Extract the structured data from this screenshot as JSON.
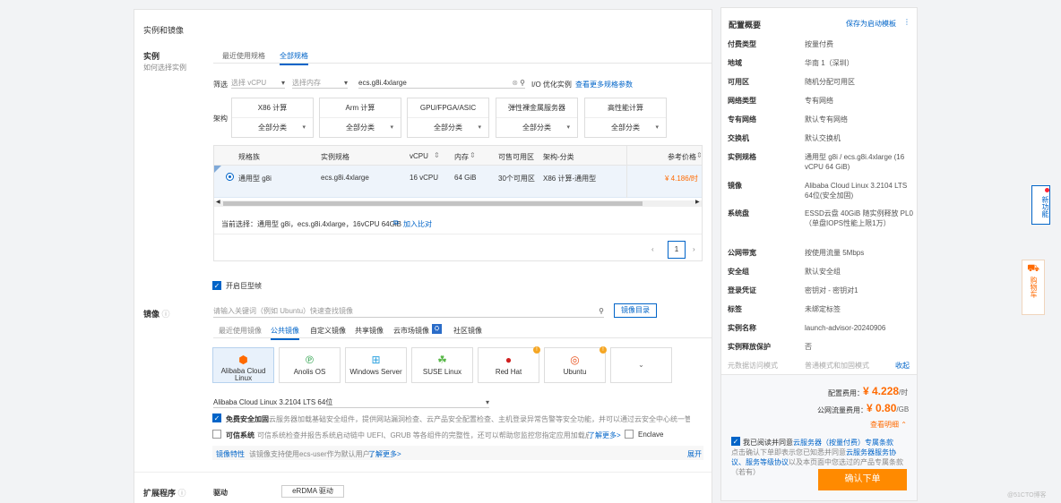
{
  "main": {
    "section_title": "实例和镜像",
    "instance": {
      "label": "实例",
      "help": "如何选择实例",
      "tabs": [
        "最近使用规格",
        "全部规格"
      ],
      "filter_label": "筛选",
      "vcpu_placeholder": "选择 vCPU",
      "memory_placeholder": "选择内存",
      "search_value": "ecs.g8i.4xlarge",
      "io_label": "I/O 优化实例",
      "more_link": "查看更多规格参数",
      "arch_label": "架构",
      "arch_categories": [
        {
          "name": "X86 计算",
          "value": "全部分类"
        },
        {
          "name": "Arm 计算",
          "value": "全部分类"
        },
        {
          "name": "GPU/FPGA/ASIC",
          "value": "全部分类"
        },
        {
          "name": "弹性裸金属服务器",
          "value": "全部分类"
        },
        {
          "name": "高性能计算",
          "value": "全部分类"
        }
      ],
      "table_headers": [
        "规格族",
        "实例规格",
        "vCPU",
        "内存",
        "可售可用区",
        "架构-分类",
        "参考价格"
      ],
      "table_row": {
        "family": "通用型 g8i",
        "spec": "ecs.g8i.4xlarge",
        "vcpu": "16 vCPU",
        "memory": "64 GiB",
        "zones": "30个可用区",
        "arch": "X86 计算-通用型",
        "price": "¥ 4.186/时"
      },
      "current_selection": "当前选择：通用型 g8i，ecs.g8i.4xlarge，16vCPU 64GiB",
      "compare_link": "加入比对",
      "page": "1",
      "hugepage_label": "开启巨型帧"
    },
    "image": {
      "label": "镜像",
      "search_placeholder": "请输入关键词（例如 Ubuntu）快速查找镜像",
      "catalog_button": "镜像目录",
      "tabs": [
        "最近使用镜像",
        "公共镜像",
        "自定义镜像",
        "共享镜像",
        "云市场镜像",
        "社区镜像"
      ],
      "os_cards": [
        "Alibaba Cloud Linux",
        "Anolis OS",
        "Windows Server",
        "SUSE Linux",
        "Red Hat",
        "Ubuntu"
      ],
      "version": "Alibaba Cloud Linux 3.2104 LTS 64位",
      "security_label": "免费安全加固",
      "security_desc": "云服务器加载基础安全组件，提供网站漏洞检查、云产品安全配置检查、主机登录异常告警等安全功能，并可以通过云安全中心统一管理",
      "trusted_label": "可信系统",
      "trusted_desc": "可信系统检查并报告系统启动链中 UEFI、GRUB 等各组件的完整性，还可以帮助您监控您指定应用加载启动情况。",
      "trusted_link": "了解更多>",
      "enclave_label": "Enclave",
      "feature_tag": "镜像特性",
      "feature_desc": "该镜像支持使用ecs-user作为默认用户，",
      "feature_link": "了解更多>",
      "expand": "展开"
    },
    "extension": {
      "label": "扩展程序",
      "driver_label": "驱动",
      "driver_button": "eRDMA 驱动"
    }
  },
  "summary": {
    "title": "配置概要",
    "save_link": "保存为启动模板",
    "rows": [
      {
        "k": "付费类型",
        "v": "按量付费"
      },
      {
        "k": "地域",
        "v": "华南 1（深圳）"
      },
      {
        "k": "可用区",
        "v": "随机分配可用区"
      },
      {
        "k": "网络类型",
        "v": "专有网络"
      },
      {
        "k": "专有网络",
        "v": "默认专有网络"
      },
      {
        "k": "交换机",
        "v": "默认交换机"
      },
      {
        "k": "实例规格",
        "v": "通用型 g8i / ecs.g8i.4xlarge (16 vCPU 64 GiB)"
      },
      {
        "k": "镜像",
        "v": "Alibaba Cloud Linux 3.2104 LTS 64位(安全加固)"
      },
      {
        "k": "系统盘",
        "v": "ESSD云盘 40GiB 随实例释放 PL0（单盘IOPS性能上限1万）"
      },
      {
        "k": "公网带宽",
        "v": "按使用流量 5Mbps"
      },
      {
        "k": "安全组",
        "v": "默认安全组"
      },
      {
        "k": "登录凭证",
        "v": "密钥对 - 密钥对1"
      },
      {
        "k": "标签",
        "v": "未绑定标签"
      },
      {
        "k": "实例名称",
        "v": "launch-advisor-20240906"
      },
      {
        "k": "实例释放保护",
        "v": "否"
      },
      {
        "k": "元数据访问模式",
        "v": "普通模式和加固模式"
      }
    ],
    "collapse": "收起",
    "config_fee_label": "配置费用：",
    "config_fee_value": "¥ 4.228",
    "config_fee_unit": "/时",
    "traffic_fee_label": "公网流量费用：",
    "traffic_fee_value": "¥ 0.80",
    "traffic_fee_unit": "/GB",
    "details_link": "查看明细",
    "agree_prefix": "我已阅读并同意",
    "agree_link": "云服务器（按量付费）专属条款",
    "agree_note_1": "点击确认下单即表示您已知悉并同意",
    "agree_link_2": "云服务器服务协议、服务等级协议",
    "agree_note_2": "以及本页面中您选过的产品专属条款（若有）",
    "submit": "确认下单"
  },
  "float": {
    "new_feature": "新功能",
    "cart": "购物车"
  },
  "watermark": "@51CTO博客",
  "colors": {
    "accent": "#0064c8",
    "orange": "#ff6a00",
    "submit": "#ff8a00"
  }
}
